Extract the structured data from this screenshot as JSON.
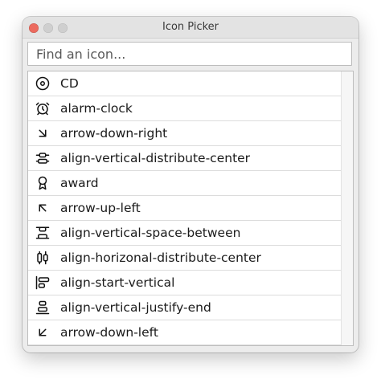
{
  "window": {
    "title": "Icon Picker"
  },
  "search": {
    "placeholder": "Find an icon...",
    "value": ""
  },
  "list": {
    "items": [
      {
        "icon": "disc-icon",
        "label": "CD"
      },
      {
        "icon": "alarm-clock-icon",
        "label": "alarm-clock"
      },
      {
        "icon": "arrow-down-right-icon",
        "label": "arrow-down-right"
      },
      {
        "icon": "align-vertical-distribute-center-icon",
        "label": "align-vertical-distribute-center"
      },
      {
        "icon": "award-icon",
        "label": "award"
      },
      {
        "icon": "arrow-up-left-icon",
        "label": "arrow-up-left"
      },
      {
        "icon": "align-vertical-space-between-icon",
        "label": "align-vertical-space-between"
      },
      {
        "icon": "align-horizontal-distribute-center-icon",
        "label": "align-horizonal-distribute-center"
      },
      {
        "icon": "align-start-vertical-icon",
        "label": "align-start-vertical"
      },
      {
        "icon": "align-vertical-justify-end-icon",
        "label": "align-vertical-justify-end"
      },
      {
        "icon": "arrow-down-left-icon",
        "label": "arrow-down-left"
      },
      {
        "icon": "partially-visible-icon",
        "label": ""
      }
    ]
  },
  "colors": {
    "close_button": "#ec6a5e",
    "window_bg": "#ececec",
    "list_bg": "#ffffff"
  }
}
